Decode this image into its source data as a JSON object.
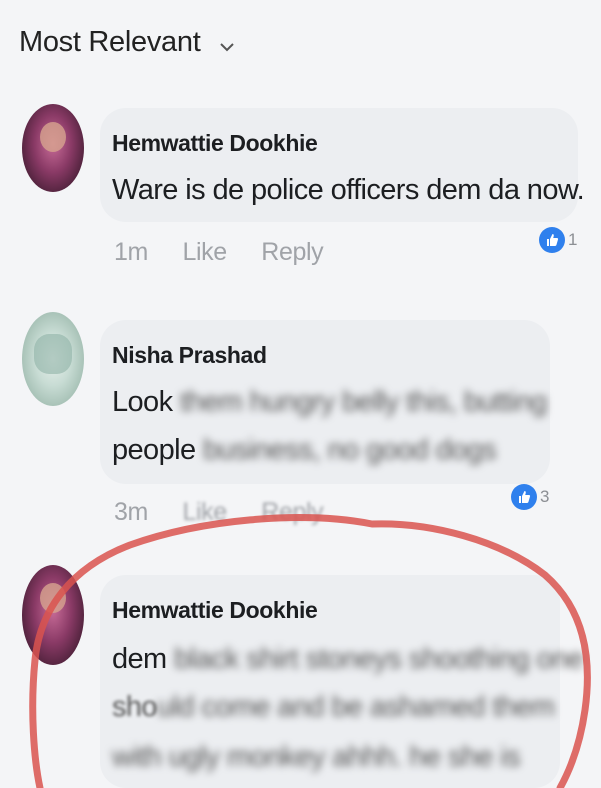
{
  "sort": {
    "label": "Most Relevant"
  },
  "comments": [
    {
      "author": "Hemwattie Dookhie",
      "lines": [
        {
          "visible": "Ware is de police officers dem da now.",
          "blurred": ""
        }
      ],
      "time": "1m",
      "like": "Like",
      "reply": "Reply",
      "reaction_count": "1"
    },
    {
      "author": "Nisha Prashad",
      "lines": [
        {
          "visible": "Look ",
          "blurred": "them hungry belly this, butting"
        },
        {
          "visible": "people ",
          "blurred": "business, no good dogs"
        }
      ],
      "time": "3m",
      "like": "Like",
      "reply": "Reply",
      "reaction_count": "3"
    },
    {
      "author": "Hemwattie Dookhie",
      "lines": [
        {
          "visible": "dem ",
          "blurred": "black shirt stoneys shoothing one"
        },
        {
          "visible": "sho",
          "blurred": "uld come and be ashamed them"
        },
        {
          "visible": "",
          "blurred": "with ugly monkey ahhh. he she is"
        }
      ]
    }
  ],
  "colors": {
    "like_blue": "#2f80ed",
    "annotation_red": "#d9534f"
  }
}
